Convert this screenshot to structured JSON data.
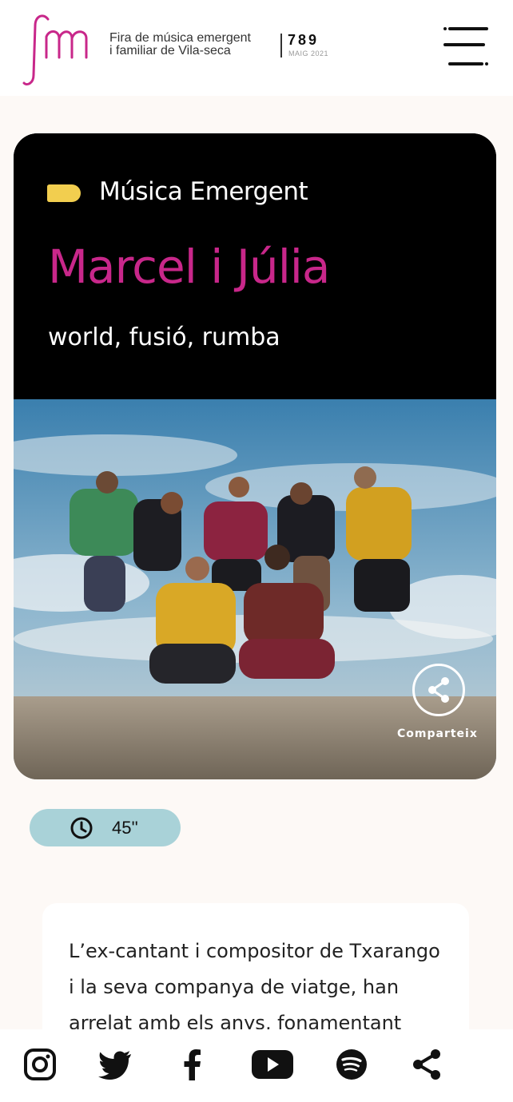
{
  "header": {
    "logo_mark": "fm",
    "logo_line1": "Fira de música emergent",
    "logo_line2": "i familiar de Vila-seca",
    "logo_days": "789",
    "logo_month": "MAIG 2021",
    "menu_icon": "hamburger-menu-icon"
  },
  "card": {
    "category": "Música Emergent",
    "artist": "Marcel i Júlia",
    "genres": "world, fusió, rumba",
    "photo_alt": "group-photo",
    "share_label": "Comparteix"
  },
  "info": {
    "duration": "45''",
    "duration_icon": "clock-icon"
  },
  "description": {
    "lines": [
      "L’ex-cantant i compositor de Txarango",
      "i la seva companya de viatge, han",
      "arrelat amb els anys, fonamentant"
    ]
  },
  "bottom_bar": {
    "icons": [
      "instagram-icon",
      "twitter-icon",
      "facebook-icon",
      "youtube-icon",
      "spotify-icon",
      "share-icon"
    ]
  },
  "colors": {
    "accent_pink": "#c8278a",
    "tag_yellow": "#f2ce4f",
    "pill_blue": "#a9d2d8",
    "background": "#fdf9f6"
  }
}
